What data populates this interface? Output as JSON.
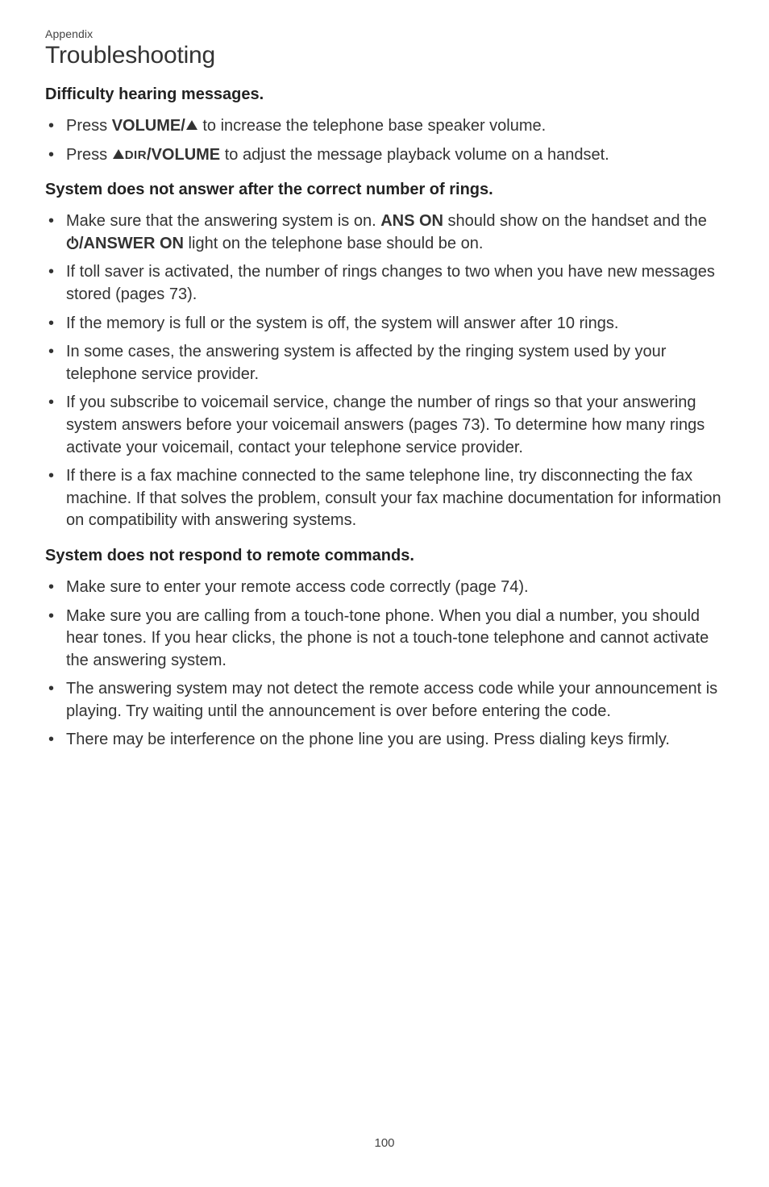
{
  "header": {
    "appendix": "Appendix",
    "title": "Troubleshooting"
  },
  "sections": [
    {
      "heading": "Difficulty hearing messages.",
      "items": [
        {
          "segments": [
            {
              "t": "Press "
            },
            {
              "t": "VOLUME/",
              "b": true
            },
            {
              "icon": "triangle-up"
            },
            {
              "t": " to increase the telephone base speaker volume."
            }
          ]
        },
        {
          "segments": [
            {
              "t": "Press "
            },
            {
              "icon": "triangle-up"
            },
            {
              "t": "DIR",
              "dirsmall": true
            },
            {
              "t": "/VOLUME",
              "b": true
            },
            {
              "t": " to adjust the message playback volume on a handset."
            }
          ]
        }
      ]
    },
    {
      "heading": "System does not answer after the correct number of rings.",
      "items": [
        {
          "segments": [
            {
              "t": "Make sure that the answering system is on. "
            },
            {
              "t": "ANS ON",
              "b": true
            },
            {
              "t": " should show on the handset and the "
            },
            {
              "icon": "power"
            },
            {
              "t": "/ANSWER ON",
              "b": true
            },
            {
              "t": " light on the telephone base should be on."
            }
          ]
        },
        {
          "segments": [
            {
              "t": "If toll saver is activated, the number of rings changes to two when you have new messages stored (pages 73)."
            }
          ]
        },
        {
          "segments": [
            {
              "t": "If the memory is full or the system is off, the system will answer after 10 rings."
            }
          ]
        },
        {
          "segments": [
            {
              "t": "In some cases, the answering system is affected by the ringing system used by your telephone service provider."
            }
          ]
        },
        {
          "segments": [
            {
              "t": "If you subscribe to voicemail service, change the number of rings so that your answering system answers before your voicemail answers (pages 73). To determine how many rings activate your voicemail, contact your telephone service provider."
            }
          ]
        },
        {
          "segments": [
            {
              "t": "If there is a fax machine connected to the same telephone line, try disconnecting the fax machine. If that solves the problem, consult your fax machine documentation for information on compatibility with answering systems."
            }
          ]
        }
      ]
    },
    {
      "heading": "System does not respond to remote commands.",
      "items": [
        {
          "segments": [
            {
              "t": "Make sure to enter your remote access code correctly (page 74)."
            }
          ]
        },
        {
          "segments": [
            {
              "t": "Make sure you are calling from a touch-tone phone. When you dial a number, you should hear tones. If you hear clicks, the phone is not a touch-tone telephone and cannot activate the answering system."
            }
          ]
        },
        {
          "segments": [
            {
              "t": "The answering system may not detect the remote access code while your announcement is playing. Try waiting until the announcement is over before entering the code."
            }
          ]
        },
        {
          "segments": [
            {
              "t": "There may be interference on the phone line you are using. Press dialing keys firmly."
            }
          ]
        }
      ]
    }
  ],
  "page_number": "100"
}
